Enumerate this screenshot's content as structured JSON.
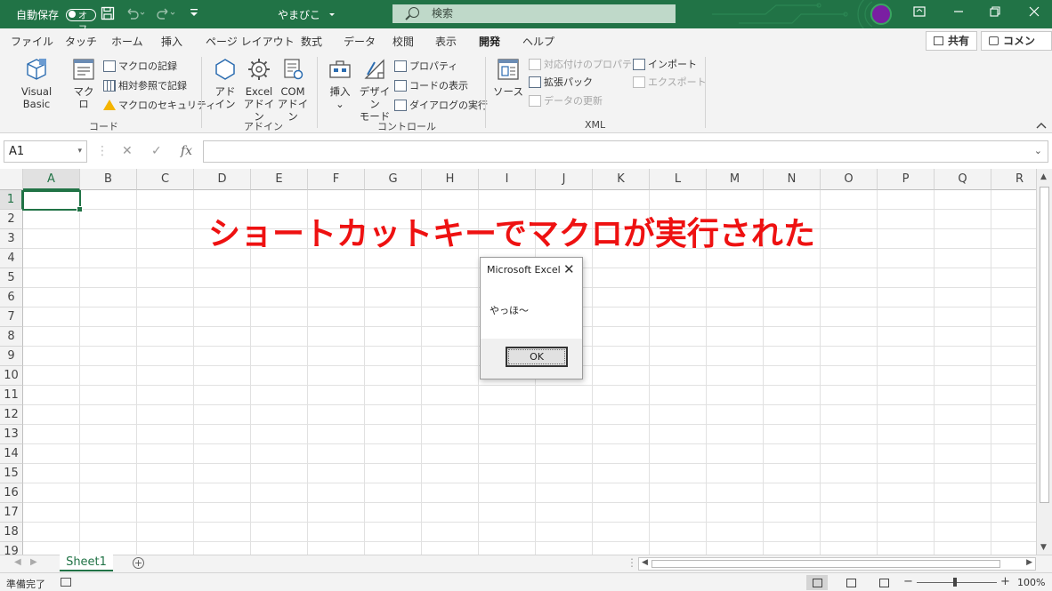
{
  "titlebar": {
    "autosave_label": "自動保存",
    "autosave_state": "オフ",
    "doc_title": "やまびこ",
    "search_placeholder": "検索"
  },
  "tabs": [
    "ファイル",
    "タッチ",
    "ホーム",
    "挿入",
    "ページ レイアウト",
    "数式",
    "データ",
    "校閲",
    "表示",
    "開発",
    "ヘルプ"
  ],
  "active_tab": "開発",
  "header_buttons": {
    "share": "共有",
    "comment": "コメント"
  },
  "ribbon": {
    "code": {
      "label": "コード",
      "visual_basic": "Visual Basic",
      "macro": "マクロ",
      "record_macro": "マクロの記録",
      "relative_ref": "相対参照で記録",
      "macro_security": "マクロのセキュリティ"
    },
    "addins": {
      "label": "アドイン",
      "addin_line1": "アド",
      "addin_line2": "イン",
      "excel_line1": "Excel",
      "excel_line2": "アドイン",
      "com_line1": "COM",
      "com_line2": "アドイン"
    },
    "controls": {
      "label": "コントロール",
      "insert": "挿入",
      "insert_arrow": "⌄",
      "design_line1": "デザイン",
      "design_line2": "モード",
      "properties": "プロパティ",
      "view_code": "コードの表示",
      "run_dialog": "ダイアログの実行"
    },
    "xml": {
      "label": "XML",
      "source": "ソース",
      "map_properties": "対応付けのプロパティ",
      "expansion_packs": "拡張パック",
      "refresh_data": "データの更新",
      "import": "インポート",
      "export": "エクスポート"
    }
  },
  "formula_bar": {
    "name_box": "A1",
    "cancel": "✕",
    "enter": "✓",
    "fx": "fx",
    "formula": ""
  },
  "columns": [
    "A",
    "B",
    "C",
    "D",
    "E",
    "F",
    "G",
    "H",
    "I",
    "J",
    "K",
    "L",
    "M",
    "N",
    "O",
    "P",
    "Q",
    "R"
  ],
  "rows": [
    "1",
    "2",
    "3",
    "4",
    "5",
    "6",
    "7",
    "8",
    "9",
    "10",
    "11",
    "12",
    "13",
    "14",
    "15",
    "16",
    "17",
    "18",
    "19"
  ],
  "active_cell": "A1",
  "overlay_text": "ショートカットキーでマクロが実行された",
  "dialog": {
    "title": "Microsoft Excel",
    "close": "✕",
    "message": "やっほ～",
    "ok_label": "OK"
  },
  "sheet_tabs": [
    "Sheet1"
  ],
  "status": {
    "ready": "準備完了",
    "zoom": "100%",
    "zoom_minus": "−",
    "zoom_plus": "+"
  },
  "colors": {
    "accent": "#217346",
    "overlay_text": "#EE1111"
  }
}
